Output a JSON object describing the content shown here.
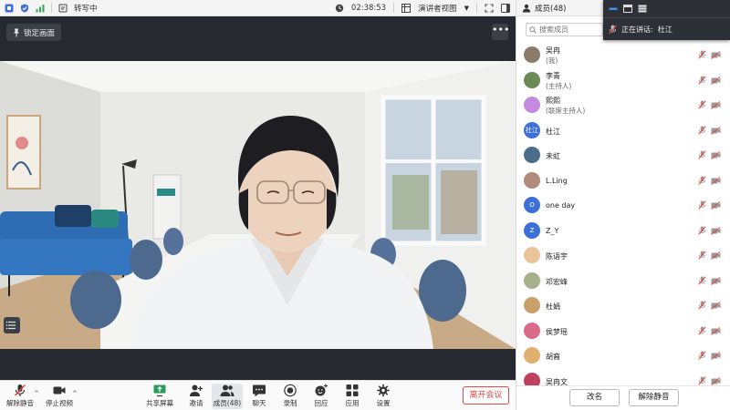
{
  "topbar": {
    "notes_label": "转写中",
    "timer": "02:38:53",
    "view_label": "演讲者视图"
  },
  "video": {
    "lock_label": "锁定画面",
    "more_label": "•••"
  },
  "toolbar": {
    "mute": "解除静音",
    "stop_video": "停止视频",
    "share_screen": "共享屏幕",
    "invite": "邀请",
    "members": "成员(48)",
    "chat": "聊天",
    "record": "录制",
    "reactions": "回应",
    "apps": "应用",
    "settings": "设置",
    "leave": "离开会议"
  },
  "panel": {
    "title": "成员(48)",
    "search_placeholder": "搜索成员",
    "rename_button": "改名",
    "unmute_button": "解除静音"
  },
  "speaking": {
    "label": "正在讲话:",
    "name": "杜江"
  },
  "members": [
    {
      "name": "吴冉",
      "role": "(我)",
      "avatar_text": "",
      "avatar_color": "#8a7b6b"
    },
    {
      "name": "李青",
      "role": "(主持人)",
      "avatar_text": "",
      "avatar_color": "#6b8a5a"
    },
    {
      "name": "熙熙",
      "role": "(联席主持人)",
      "avatar_text": "",
      "avatar_color": "#c58ae0"
    },
    {
      "name": "杜江",
      "role": "",
      "avatar_text": "杜江",
      "avatar_color": "#3d6fd9"
    },
    {
      "name": "未虹",
      "role": "",
      "avatar_text": "",
      "avatar_color": "#4a6d8c"
    },
    {
      "name": "L.Ling",
      "role": "",
      "avatar_text": "",
      "avatar_color": "#b08a7a"
    },
    {
      "name": "one day",
      "role": "",
      "avatar_text": "O",
      "avatar_color": "#3d6fd9"
    },
    {
      "name": "Z_Y",
      "role": "",
      "avatar_text": "Z",
      "avatar_color": "#3d6fd9"
    },
    {
      "name": "陈语宇",
      "role": "",
      "avatar_text": "",
      "avatar_color": "#e8c49a"
    },
    {
      "name": "邓宏峰",
      "role": "",
      "avatar_text": "",
      "avatar_color": "#a8b08a"
    },
    {
      "name": "杜娟",
      "role": "",
      "avatar_text": "",
      "avatar_color": "#c9a06a"
    },
    {
      "name": "侯梦瑶",
      "role": "",
      "avatar_text": "",
      "avatar_color": "#d86a8a"
    },
    {
      "name": "胡裔",
      "role": "",
      "avatar_text": "",
      "avatar_color": "#e0b070"
    },
    {
      "name": "吴冉文",
      "role": "",
      "avatar_text": "",
      "avatar_color": "#c04060"
    }
  ],
  "colors": {
    "accent_blue": "#3d6fd9",
    "leave_red": "#e5483e",
    "muted_red": "#e5483e",
    "video_bg": "#262a30"
  }
}
